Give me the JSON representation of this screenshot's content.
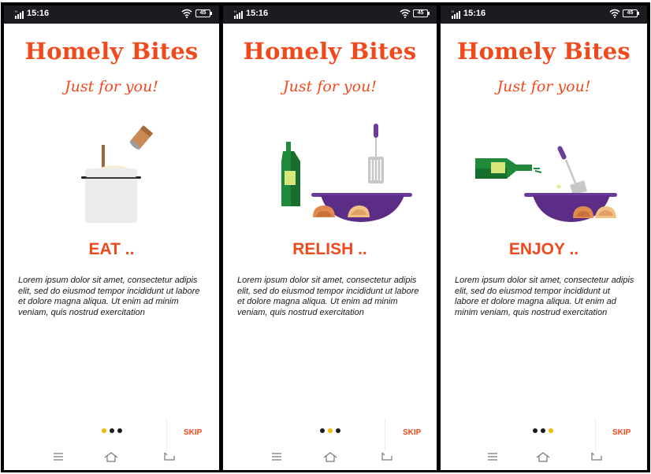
{
  "status": {
    "time": "15:16",
    "battery": "45"
  },
  "screens": [
    {
      "app_title": "Homely Bites",
      "tagline": "Just for you!",
      "heading": "EAT ..",
      "body": "Lorem ipsum dolor sit amet, consectetur adipis elit, sed do eiusmod tempor incididunt ut labore et dolore magna aliqua. Ut enim ad minim veniam, quis nostrud exercitation",
      "skip_label": "SKIP",
      "active_page": 1,
      "illustration": "pot-and-salt-shaker"
    },
    {
      "app_title": "Homely Bites",
      "tagline": "Just for you!",
      "heading": "RELISH ..",
      "body": "Lorem ipsum dolor sit amet, consectetur adipis elit, sed do eiusmod tempor incididunt ut labore et dolore magna aliqua. Ut enim ad minim veniam, quis nostrud exercitation",
      "skip_label": "SKIP",
      "active_page": 2,
      "illustration": "oil-bottle-spatula-wok"
    },
    {
      "app_title": "Homely Bites",
      "tagline": "Just for you!",
      "heading": "ENJOY ..",
      "body": "Lorem ipsum dolor sit amet, consectetur adipis elit, sed do eiusmod tempor incididunt ut labore et dolore magna aliqua. Ut enim ad minim veniam, quis nostrud exercitation",
      "skip_label": "SKIP",
      "active_page": 3,
      "illustration": "pouring-oil-wok"
    }
  ],
  "page_count": 3,
  "colors": {
    "accent": "#f04a1c",
    "active_dot": "#f5b800",
    "dot": "#1c1c1c",
    "status_bar": "#1b1c22",
    "wok": "#5b2d86",
    "bottle": "#1e8a3a"
  },
  "nav_icons": [
    "menu-icon",
    "home-icon",
    "back-icon"
  ]
}
